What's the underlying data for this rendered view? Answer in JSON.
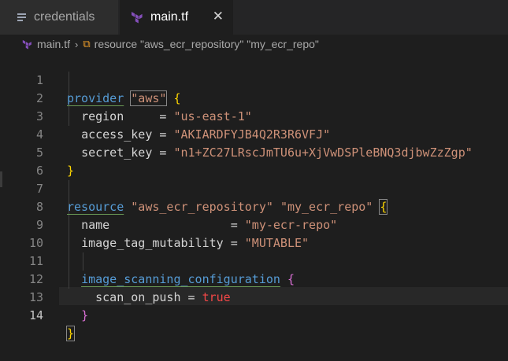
{
  "tabs": [
    {
      "label": "credentials",
      "icon": "lines-icon",
      "active": false
    },
    {
      "label": "main.tf",
      "icon": "terraform-icon",
      "active": true
    }
  ],
  "breadcrumb": {
    "file": "main.tf",
    "symbol": "resource \"aws_ecr_repository\" \"my_ecr_repo\""
  },
  "editor": {
    "active_line": 14,
    "line_numbers": [
      "1",
      "2",
      "3",
      "4",
      "5",
      "6",
      "7",
      "8",
      "9",
      "10",
      "11",
      "12",
      "13",
      "14"
    ],
    "lines": {
      "l1": {
        "kw": "provider",
        "name": "\"aws\"",
        "brace": "{"
      },
      "l2": {
        "key": "region",
        "eq": "     = ",
        "val": "\"us-east-1\""
      },
      "l3": {
        "key": "access_key",
        "eq": " = ",
        "val": "\"AKIARDFYJB4Q2R3R6VFJ\""
      },
      "l4": {
        "key": "secret_key",
        "eq": " = ",
        "val": "\"n1+ZC27LRscJmTU6u+XjVwDSPleBNQ3djbwZzZgp\""
      },
      "l5": {
        "brace": "}"
      },
      "l7": {
        "kw": "resource",
        "type": "\"aws_ecr_repository\"",
        "name": "\"my_ecr_repo\"",
        "brace": "{"
      },
      "l8": {
        "key": "name",
        "eq": "                 = ",
        "val": "\"my-ecr-repo\""
      },
      "l9": {
        "key": "image_tag_mutability",
        "eq": " = ",
        "val": "\"MUTABLE\""
      },
      "l11": {
        "block": "image_scanning_configuration",
        "brace": "{"
      },
      "l12": {
        "key": "scan_on_push",
        "eq": " = ",
        "val": "true"
      },
      "l13": {
        "brace": "}"
      },
      "l14": {
        "brace": "}"
      }
    }
  },
  "colors": {
    "background": "#1e1e1e",
    "keyword": "#569cd6",
    "string": "#ce9178",
    "boolean": "#f44747",
    "bracket_level1": "#ffd700",
    "bracket_level2": "#da70d6"
  }
}
